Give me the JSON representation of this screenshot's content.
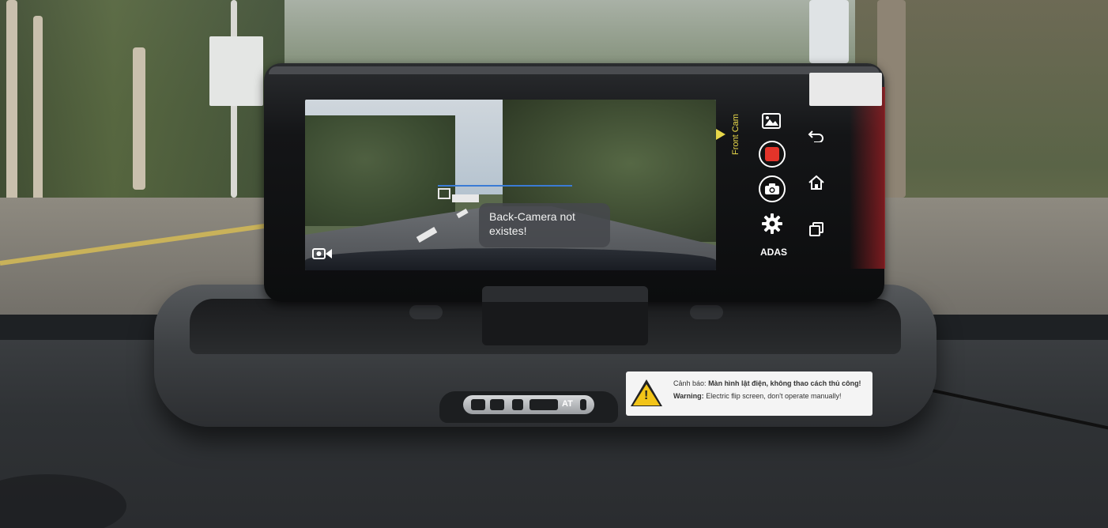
{
  "screen": {
    "toast_text": "Back-Camera not existes!",
    "front_cam_label": "Front Cam",
    "adas_label": "ADAS"
  },
  "side_buttons": {
    "left": [
      {
        "icon": "gallery-icon"
      },
      {
        "icon": "record-icon",
        "color": "#e4342a"
      },
      {
        "icon": "camera-icon"
      },
      {
        "icon": "settings-icon"
      }
    ],
    "right": [
      {
        "icon": "back-icon"
      },
      {
        "icon": "home-icon"
      },
      {
        "icon": "recents-icon"
      }
    ]
  },
  "warning_sticker": {
    "line1_label": "Cảnh báo:",
    "line1_text": "Màn hình lật điện, không thao cách thủ công!",
    "line2_label": "Warning:",
    "line2_text": "Electric flip screen, don't operate manually!"
  },
  "ports_label": "AT",
  "colors": {
    "accent_yellow": "#e8d84a",
    "record_red": "#e4342a",
    "warning_yellow": "#f2c418"
  }
}
